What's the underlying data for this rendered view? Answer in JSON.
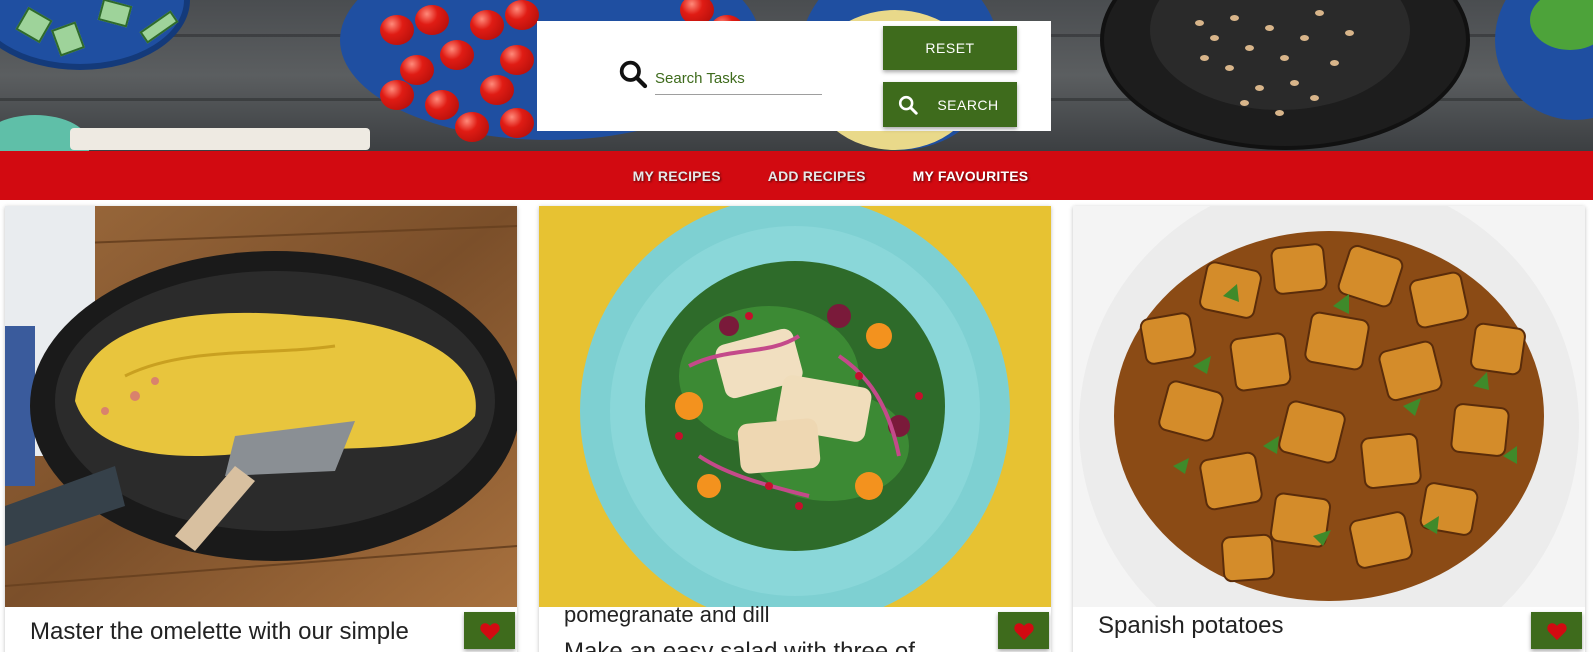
{
  "search": {
    "placeholder": "Search Tasks",
    "reset_label": "RESET",
    "search_label": "SEARCH"
  },
  "nav": {
    "items": [
      {
        "label": "MY RECIPES"
      },
      {
        "label": "ADD RECIPES"
      },
      {
        "label": "MY FAVOURITES"
      }
    ]
  },
  "recipes": [
    {
      "title": "Master the omelette with our simple",
      "image": "omelette-in-pan-photo",
      "favourite_icon": "heart-icon"
    },
    {
      "title_line1": "pomegranate and dill",
      "title_line2": "Make an easy salad with three of",
      "image": "halloumi-salad-photo",
      "favourite_icon": "heart-icon"
    },
    {
      "title": "Spanish potatoes",
      "image": "spanish-potatoes-photo",
      "favourite_icon": "heart-icon"
    }
  ],
  "colors": {
    "primary_green": "#3e6b1c",
    "nav_red": "#d20a11",
    "background": "#ffffff"
  }
}
